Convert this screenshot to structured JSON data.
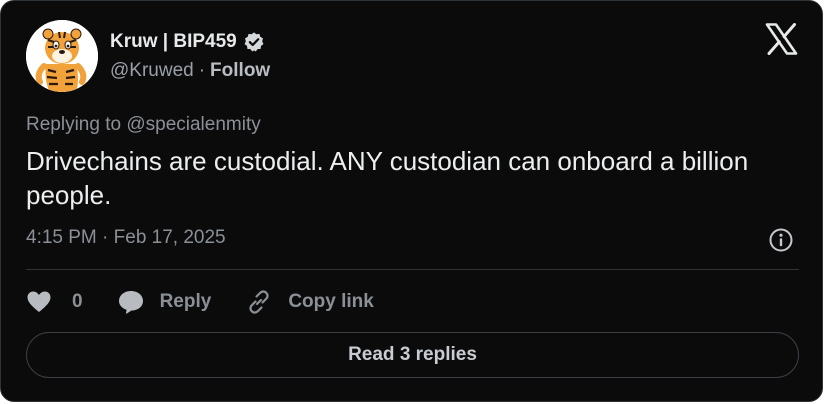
{
  "author": {
    "display_name": "Kruw | BIP459",
    "handle": "@Kruwed",
    "separator": "·",
    "follow_label": "Follow"
  },
  "tweet": {
    "replying_to": "Replying to @specialenmity",
    "text": "Drivechains are custodial. ANY custodian can onboard a billion people.",
    "timestamp": "4:15 PM · Feb 17, 2025"
  },
  "actions": {
    "like_count": "0",
    "reply_label": "Reply",
    "copy_label": "Copy link"
  },
  "footer": {
    "read_replies_label": "Read 3 replies"
  },
  "icons": {
    "brand": "x-logo-icon",
    "verified": "verified-badge-icon",
    "info": "info-icon",
    "like": "heart-icon",
    "reply": "speech-bubble-icon",
    "copy": "link-icon"
  },
  "colors": {
    "background": "#0b0b0c",
    "text": "#e7e9ea",
    "muted": "#8b9096",
    "border": "#2f3336"
  }
}
